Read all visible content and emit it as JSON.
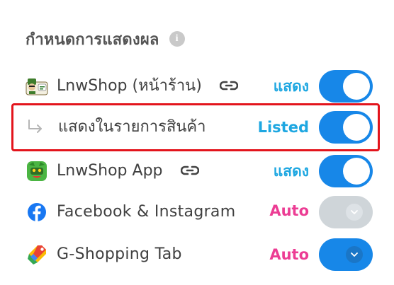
{
  "header": {
    "title": "กำหนดการแสดงผล",
    "info_icon": "info-icon"
  },
  "rows": [
    {
      "id": "lnwshop-store",
      "icon": "lnwshop-store-icon",
      "label": "LnwShop (หน้าร้าน)",
      "has_link_icon": true,
      "status": "แสดง",
      "status_color": "#1ea7e1",
      "control": "toggle",
      "enabled": true
    },
    {
      "id": "show-in-product-list",
      "icon": "sub-item-arrow-icon",
      "label": "แสดงในรายการสินค้า",
      "status": "Listed",
      "status_color": "#1ea7e1",
      "control": "toggle",
      "enabled": true,
      "highlighted": true
    },
    {
      "id": "lnwshop-app",
      "icon": "lnwshop-app-icon",
      "label": "LnwShop App",
      "has_link_icon": true,
      "status": "แสดง",
      "status_color": "#1ea7e1",
      "control": "toggle",
      "enabled": true
    },
    {
      "id": "facebook-instagram",
      "icon": "facebook-icon",
      "label": "Facebook & Instagram",
      "status": "Auto",
      "status_color": "#ec3d94",
      "control": "dropdown",
      "enabled": false
    },
    {
      "id": "g-shopping-tab",
      "icon": "google-shopping-icon",
      "label": "G-Shopping Tab",
      "status": "Auto",
      "status_color": "#ec3d94",
      "control": "dropdown",
      "enabled": true
    }
  ],
  "colors": {
    "accent": "#1787e8",
    "status_blue": "#1ea7e1",
    "status_pink": "#ec3d94",
    "disabled": "#cfd5d9",
    "highlight_border": "#e3141c"
  }
}
